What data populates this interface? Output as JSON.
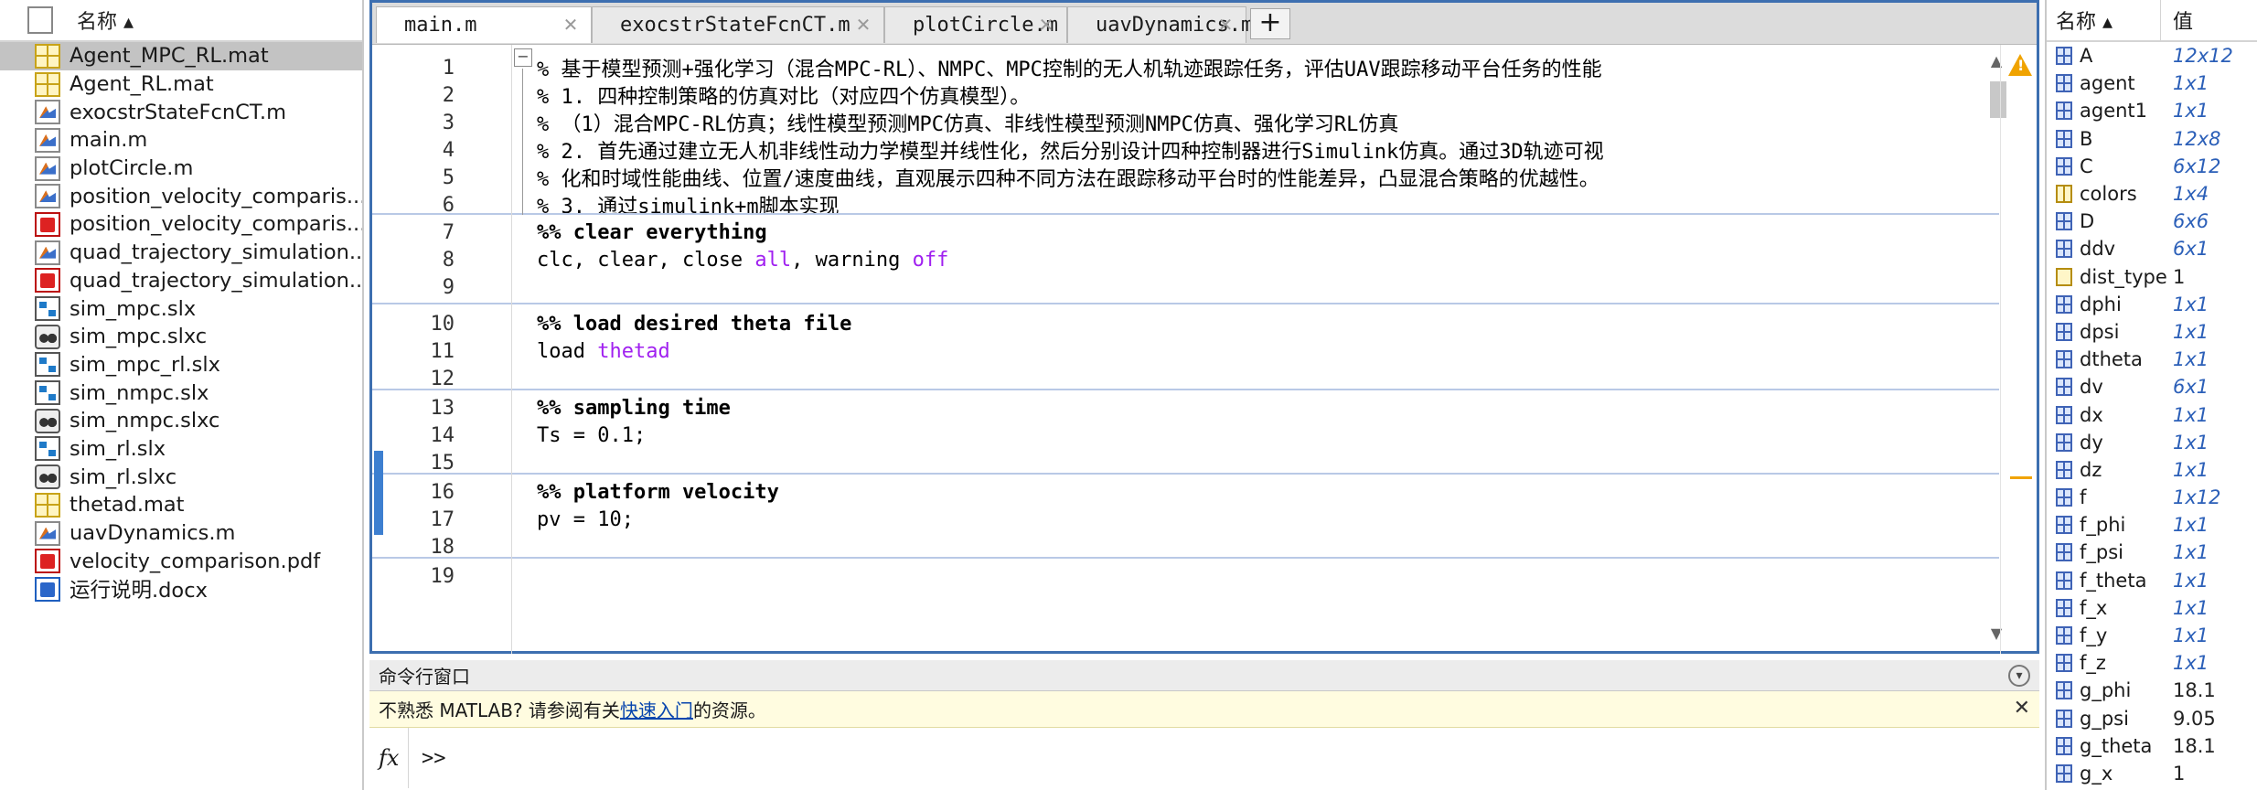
{
  "file_browser": {
    "header": "名称 ▴",
    "files": [
      {
        "name": "Agent_MPC_RL.mat",
        "type": "mat",
        "selected": true
      },
      {
        "name": "Agent_RL.mat",
        "type": "mat"
      },
      {
        "name": "exocstrStateFcnCT.m",
        "type": "m"
      },
      {
        "name": "main.m",
        "type": "m"
      },
      {
        "name": "plotCircle.m",
        "type": "m"
      },
      {
        "name": "position_velocity_comparis...",
        "type": "m"
      },
      {
        "name": "position_velocity_comparis...",
        "type": "pdf"
      },
      {
        "name": "quad_trajectory_simulation....",
        "type": "m"
      },
      {
        "name": "quad_trajectory_simulation....",
        "type": "pdf"
      },
      {
        "name": "sim_mpc.slx",
        "type": "slx"
      },
      {
        "name": "sim_mpc.slxc",
        "type": "slxc"
      },
      {
        "name": "sim_mpc_rl.slx",
        "type": "slx"
      },
      {
        "name": "sim_nmpc.slx",
        "type": "slx"
      },
      {
        "name": "sim_nmpc.slxc",
        "type": "slxc"
      },
      {
        "name": "sim_rl.slx",
        "type": "slx"
      },
      {
        "name": "sim_rl.slxc",
        "type": "slxc"
      },
      {
        "name": "thetad.mat",
        "type": "mat"
      },
      {
        "name": "uavDynamics.m",
        "type": "m"
      },
      {
        "name": "velocity_comparison.pdf",
        "type": "pdf"
      },
      {
        "name": "运行说明.docx",
        "type": "docx"
      }
    ]
  },
  "editor": {
    "tabs": [
      {
        "label": "main.m",
        "active": true
      },
      {
        "label": "exocstrStateFcnCT.m"
      },
      {
        "label": "plotCircle.m"
      },
      {
        "label": "uavDynamics.m"
      }
    ],
    "add_tab": "+",
    "lines": [
      {
        "n": "1",
        "text": "% 基于模型预测+强化学习（混合MPC-RL）、NMPC、MPC控制的无人机轨迹跟踪任务，评估UAV跟踪移动平台任务的性能",
        "kind": "cmt"
      },
      {
        "n": "2",
        "text": "% 1. 四种控制策略的仿真对比（对应四个仿真模型）。",
        "kind": "cmt"
      },
      {
        "n": "3",
        "text": "% （1）混合MPC-RL仿真；线性模型预测MPC仿真、非线性模型预测NMPC仿真、强化学习RL仿真",
        "kind": "cmt"
      },
      {
        "n": "4",
        "text": "% 2. 首先通过建立无人机非线性动力学模型并线性化，然后分别设计四种控制器进行Simulink仿真。通过3D轨迹可视",
        "kind": "cmt"
      },
      {
        "n": "5",
        "text": "% 化和时域性能曲线、位置/速度曲线，直观展示四种不同方法在跟踪移动平台时的性能差异，凸显混合策略的优越性。",
        "kind": "cmt"
      },
      {
        "n": "6",
        "text": "% 3. 通过simulink+m脚本实现",
        "kind": "cmt"
      },
      {
        "n": "7",
        "text": "%% clear everything",
        "kind": "cell"
      },
      {
        "n": "8",
        "text_a": "clc, clear, close ",
        "kw_a": "all",
        "text_b": ", warning ",
        "kw_b": "off",
        "kind": "mixed"
      },
      {
        "n": "9",
        "text": "",
        "kind": "code"
      },
      {
        "n": "10",
        "text": "%% load desired theta file",
        "kind": "cell"
      },
      {
        "n": "11",
        "text_a": "load ",
        "kw_a": "thetad",
        "kind": "mixed1"
      },
      {
        "n": "12",
        "text": "",
        "kind": "code"
      },
      {
        "n": "13",
        "text": "%% sampling time",
        "kind": "cell"
      },
      {
        "n": "14",
        "text": "Ts = 0.1;",
        "kind": "code"
      },
      {
        "n": "15",
        "text": "",
        "kind": "code"
      },
      {
        "n": "16",
        "text": "%% platform velocity",
        "kind": "cell"
      },
      {
        "n": "17",
        "text": "pv = 10;",
        "kind": "code"
      },
      {
        "n": "18",
        "text": "",
        "kind": "code"
      },
      {
        "n": "19",
        "text": "",
        "kind": "code"
      }
    ]
  },
  "command_window": {
    "title": "命令行窗口",
    "notice_a": "不熟悉 MATLAB? 请参阅有关",
    "notice_link": "快速入门",
    "notice_b": "的资源。",
    "prompt": ">>",
    "fx": "fx"
  },
  "workspace": {
    "col_name": "名称 ▴",
    "col_value": "值",
    "vars": [
      {
        "name": "A",
        "value": "12x12",
        "kind": "mat"
      },
      {
        "name": "agent",
        "value": "1x1",
        "kind": "mat"
      },
      {
        "name": "agent1",
        "value": "1x1",
        "kind": "mat"
      },
      {
        "name": "B",
        "value": "12x8",
        "kind": "mat"
      },
      {
        "name": "C",
        "value": "6x12",
        "kind": "mat"
      },
      {
        "name": "colors",
        "value": "1x4",
        "kind": "cell"
      },
      {
        "name": "D",
        "value": "6x6",
        "kind": "mat"
      },
      {
        "name": "ddv",
        "value": "6x1",
        "kind": "mat"
      },
      {
        "name": "dist_type",
        "value": "1",
        "kind": "str",
        "plain": true
      },
      {
        "name": "dphi",
        "value": "1x1",
        "kind": "mat"
      },
      {
        "name": "dpsi",
        "value": "1x1",
        "kind": "mat"
      },
      {
        "name": "dtheta",
        "value": "1x1",
        "kind": "mat"
      },
      {
        "name": "dv",
        "value": "6x1",
        "kind": "mat"
      },
      {
        "name": "dx",
        "value": "1x1",
        "kind": "mat"
      },
      {
        "name": "dy",
        "value": "1x1",
        "kind": "mat"
      },
      {
        "name": "dz",
        "value": "1x1",
        "kind": "mat"
      },
      {
        "name": "f",
        "value": "1x12",
        "kind": "mat"
      },
      {
        "name": "f_phi",
        "value": "1x1",
        "kind": "mat"
      },
      {
        "name": "f_psi",
        "value": "1x1",
        "kind": "mat"
      },
      {
        "name": "f_theta",
        "value": "1x1",
        "kind": "mat"
      },
      {
        "name": "f_x",
        "value": "1x1",
        "kind": "mat"
      },
      {
        "name": "f_y",
        "value": "1x1",
        "kind": "mat"
      },
      {
        "name": "f_z",
        "value": "1x1",
        "kind": "mat"
      },
      {
        "name": "g_phi",
        "value": "18.1",
        "kind": "mat",
        "plain": true
      },
      {
        "name": "g_psi",
        "value": "9.05",
        "kind": "mat",
        "plain": true
      },
      {
        "name": "g_theta",
        "value": "18.1",
        "kind": "mat",
        "plain": true
      },
      {
        "name": "g_x",
        "value": "1",
        "kind": "mat",
        "plain": true
      }
    ]
  }
}
